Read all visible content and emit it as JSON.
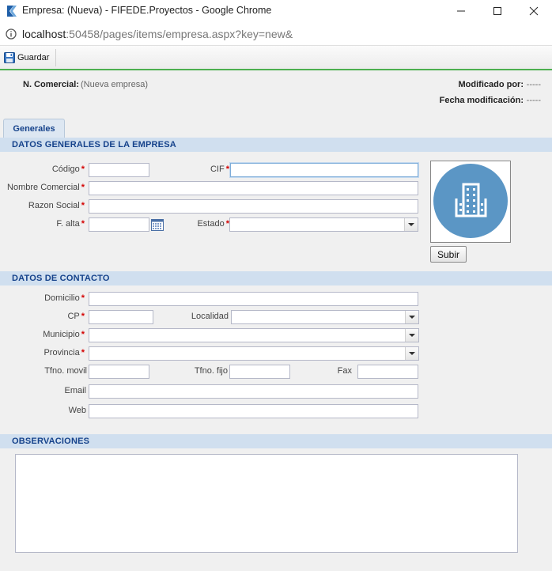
{
  "window": {
    "title": "Empresa: (Nueva) - FIFEDE.Proyectos - Google Chrome",
    "url_host": "localhost",
    "url_path": ":50458/pages/items/empresa.aspx?key=new&"
  },
  "toolbar": {
    "save_label": "Guardar"
  },
  "header": {
    "nombre_label": "N. Comercial:",
    "nombre_value": "(Nueva empresa)",
    "modificado_label": "Modificado por:",
    "modificado_value": "-----",
    "fecha_label": "Fecha modificación:",
    "fecha_value": "-----"
  },
  "tabs": [
    {
      "label": "Generales"
    }
  ],
  "sections": {
    "generales": "DATOS GENERALES DE LA EMPRESA",
    "contacto": "DATOS DE CONTACTO",
    "observaciones": "OBSERVACIONES"
  },
  "fields": {
    "codigo": {
      "label": "Código",
      "value": ""
    },
    "cif": {
      "label": "CIF",
      "value": ""
    },
    "nombre_comercial": {
      "label": "Nombre Comercial",
      "value": ""
    },
    "razon_social": {
      "label": "Razon Social",
      "value": ""
    },
    "f_alta": {
      "label": "F. alta",
      "value": ""
    },
    "estado": {
      "label": "Estado",
      "value": ""
    },
    "domicilio": {
      "label": "Domicilio",
      "value": ""
    },
    "cp": {
      "label": "CP",
      "value": ""
    },
    "localidad": {
      "label": "Localidad",
      "value": ""
    },
    "municipio": {
      "label": "Municipio",
      "value": ""
    },
    "provincia": {
      "label": "Provincia",
      "value": ""
    },
    "tfno_movil": {
      "label": "Tfno. movil",
      "value": ""
    },
    "tfno_fijo": {
      "label": "Tfno. fijo",
      "value": ""
    },
    "fax": {
      "label": "Fax",
      "value": ""
    },
    "email": {
      "label": "Email",
      "value": ""
    },
    "web": {
      "label": "Web",
      "value": ""
    }
  },
  "required_marker": "*",
  "upload_label": "Subir",
  "colors": {
    "accent_green": "#4caf50",
    "section_bg": "#d0dfef",
    "section_text": "#15428b",
    "required": "#d40000",
    "logo_circle": "#5b96c5"
  },
  "icons": [
    "app-icon",
    "info-icon",
    "save-icon",
    "calendar-icon",
    "building-icon",
    "chevron-down-icon"
  ]
}
